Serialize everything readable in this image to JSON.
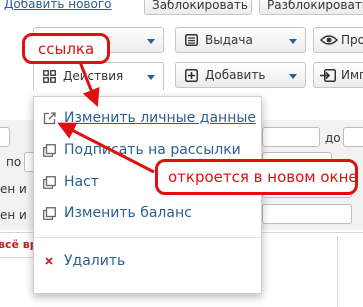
{
  "top_buttons": {
    "add_new": "Добавить нового",
    "block": "Заблокировать",
    "unblock": "Разблокировать"
  },
  "toolbar": {
    "issue": "Выдача",
    "view": "Про",
    "actions": "Действия",
    "add": "Добавить",
    "import": "Имп"
  },
  "filters": {
    "from_label": "по",
    "to_label": "до",
    "row1_tail": "ен и",
    "row2_tail": "ен и",
    "hint": "всё вре"
  },
  "dropdown": {
    "items": [
      {
        "label": "Изменить личные данные",
        "icon": "external-link-icon"
      },
      {
        "label": "Подписать на рассылки",
        "icon": "copy-icon"
      },
      {
        "label": "Наст",
        "icon": "copy-icon"
      },
      {
        "label": "Изменить баланс",
        "icon": "copy-icon"
      },
      {
        "label": "Удалить",
        "icon": "close-icon"
      }
    ]
  },
  "annotations": {
    "link_callout": "ссылка",
    "new_window_callout": "откроется в новом окне"
  },
  "colors": {
    "link": "#2b5f91",
    "annotation_red": "#e01010",
    "delete_red": "#cc2222"
  }
}
